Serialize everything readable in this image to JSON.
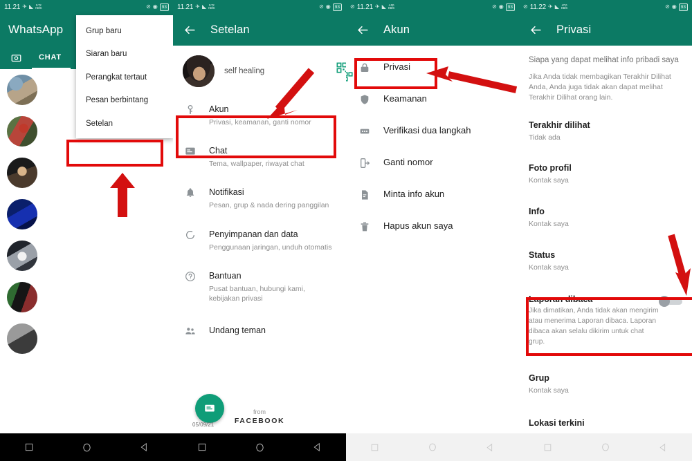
{
  "meta": {
    "accent_green": "#0c7a64",
    "fab_green": "#0f9d78",
    "highlight_red": "#e20a0a"
  },
  "panel1": {
    "status": {
      "time": "11.21",
      "airplane_icon": "airplane-icon",
      "wifi_icon": "wifi-icon",
      "wifi_rate_top": "0.72",
      "wifi_rate_bottom": "KB/S",
      "mute_icon": "mute-icon",
      "alarm_icon": "alarm-icon",
      "battery": "93"
    },
    "appbar": {
      "title": "WhatsApp"
    },
    "tabs": {
      "camera_icon": "camera-icon",
      "items": [
        "CHAT"
      ],
      "active": "CHAT"
    },
    "menu": {
      "items": [
        {
          "label": "Grup baru"
        },
        {
          "label": "Siaran baru"
        },
        {
          "label": "Perangkat tertaut"
        },
        {
          "label": "Pesan berbintang"
        },
        {
          "label": "Setelan",
          "highlighted": true
        }
      ]
    },
    "chats": [
      {
        "avatar": "avatar-1"
      },
      {
        "avatar": "avatar-2"
      },
      {
        "avatar": "avatar-3"
      },
      {
        "avatar": "avatar-4"
      },
      {
        "avatar": "avatar-5"
      },
      {
        "avatar": "avatar-6"
      },
      {
        "avatar": "avatar-7"
      }
    ]
  },
  "panel2": {
    "status": {
      "time": "11.21",
      "mute_icon": "mute-icon",
      "alarm_icon": "alarm-icon",
      "battery": "93",
      "wifi_rate_top": "0.72",
      "wifi_rate_bottom": "KB/S"
    },
    "appbar": {
      "back_icon": "back-arrow-icon",
      "title": "Setelan"
    },
    "profile": {
      "name": "self healing",
      "qr_icon": "qr-code-icon",
      "avatar": "profile-photo"
    },
    "items": [
      {
        "icon": "key-icon",
        "title": "Akun",
        "subtitle": "Privasi, keamanan, ganti nomor",
        "highlighted": true
      },
      {
        "icon": "chat-icon",
        "title": "Chat",
        "subtitle": "Tema, wallpaper, riwayat chat"
      },
      {
        "icon": "bell-icon",
        "title": "Notifikasi",
        "subtitle": "Pesan, grup & nada dering panggilan"
      },
      {
        "icon": "storage-icon",
        "title": "Penyimpanan dan data",
        "subtitle": "Penggunaan jaringan, unduh otomatis"
      },
      {
        "icon": "help-icon",
        "title": "Bantuan",
        "subtitle": "Pusat bantuan, hubungi kami, kebijakan privasi"
      },
      {
        "icon": "people-icon",
        "title": "Undang teman",
        "subtitle": ""
      }
    ],
    "fab": {
      "icon": "new-chat-icon",
      "date_label": "05/09/21"
    },
    "footer": {
      "from": "from",
      "brand": "FACEBOOK"
    }
  },
  "panel3": {
    "status": {
      "time": "11.21",
      "battery": "93",
      "wifi_rate_top": "4.00",
      "wifi_rate_bottom": "KB/S"
    },
    "appbar": {
      "back_icon": "back-arrow-icon",
      "title": "Akun"
    },
    "items": [
      {
        "icon": "lock-icon",
        "title": "Privasi",
        "highlighted": true
      },
      {
        "icon": "shield-icon",
        "title": "Keamanan"
      },
      {
        "icon": "two-step-icon",
        "title": "Verifikasi dua langkah"
      },
      {
        "icon": "change-number-icon",
        "title": "Ganti nomor"
      },
      {
        "icon": "document-icon",
        "title": "Minta info akun"
      },
      {
        "icon": "trash-icon",
        "title": "Hapus akun saya"
      }
    ],
    "qr_icon": "qr-code-icon"
  },
  "panel4": {
    "status": {
      "time": "11.22",
      "battery": "93",
      "wifi_rate_top": "47.0",
      "wifi_rate_bottom": "KB/S"
    },
    "appbar": {
      "back_icon": "back-arrow-icon",
      "title": "Privasi"
    },
    "header": {
      "section_label": "Siapa yang dapat melihat info pribadi saya",
      "note": "Jika Anda tidak membagikan Terakhir Dilihat Anda, Anda juga tidak akan dapat melihat Terakhir Dilihat orang lain."
    },
    "rows": [
      {
        "title": "Terakhir dilihat",
        "subtitle": "Tidak ada"
      },
      {
        "title": "Foto profil",
        "subtitle": "Kontak saya"
      },
      {
        "title": "Info",
        "subtitle": "Kontak saya"
      },
      {
        "title": "Status",
        "subtitle": "Kontak saya"
      },
      {
        "title": "Laporan dibaca",
        "subtitle": "Jika dimatikan, Anda tidak akan mengirim atau menerima Laporan dibaca. Laporan dibaca akan selalu dikirim untuk chat grup.",
        "toggle": "off",
        "highlighted": true
      },
      {
        "title": "Grup",
        "subtitle": "Kontak saya"
      },
      {
        "title": "Lokasi terkini",
        "subtitle": ""
      }
    ]
  },
  "navbar": {
    "recents_icon": "square-recents-icon",
    "home_icon": "circle-home-icon",
    "back_icon": "triangle-back-icon"
  }
}
